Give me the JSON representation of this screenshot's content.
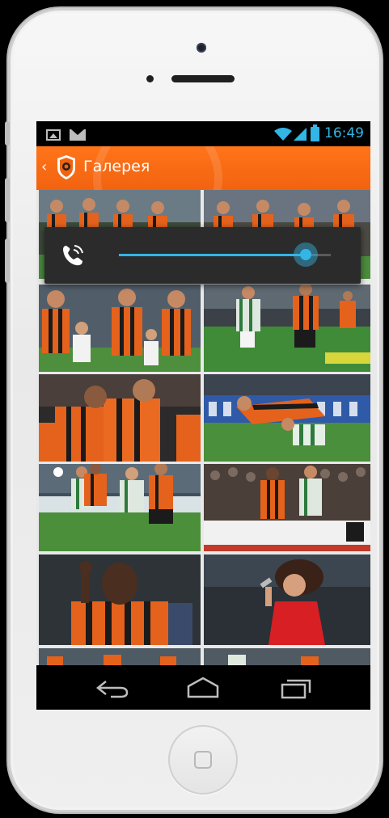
{
  "statusbar": {
    "time": "16:49",
    "icons": [
      "image-notification-icon",
      "mail-notification-icon",
      "wifi-icon",
      "signal-icon",
      "battery-icon"
    ],
    "accent_color": "#33b5e5"
  },
  "actionbar": {
    "back_glyph": "‹",
    "title": "Галерея",
    "color": "#f26310"
  },
  "volume": {
    "stream_icon": "ringer-phone-icon",
    "level": 0.88
  },
  "gallery": {
    "photos": [
      {
        "row": 0,
        "col": 0,
        "style": "team-orange"
      },
      {
        "row": 0,
        "col": 1,
        "style": "team-orange"
      },
      {
        "row": 1,
        "col": 0,
        "style": "team-kids"
      },
      {
        "row": 1,
        "col": 1,
        "style": "match-green"
      },
      {
        "row": 2,
        "col": 0,
        "style": "celebration"
      },
      {
        "row": 2,
        "col": 1,
        "style": "tackle"
      },
      {
        "row": 3,
        "col": 0,
        "style": "match-green"
      },
      {
        "row": 3,
        "col": 1,
        "style": "match-crowd"
      },
      {
        "row": 4,
        "col": 0,
        "style": "portrait"
      },
      {
        "row": 4,
        "col": 1,
        "style": "singer"
      },
      {
        "row": 5,
        "col": 0,
        "style": "team-orange"
      },
      {
        "row": 5,
        "col": 1,
        "style": "match-green"
      }
    ]
  },
  "navbar": {
    "buttons": [
      "back-nav-icon",
      "home-nav-icon",
      "recents-nav-icon"
    ]
  }
}
